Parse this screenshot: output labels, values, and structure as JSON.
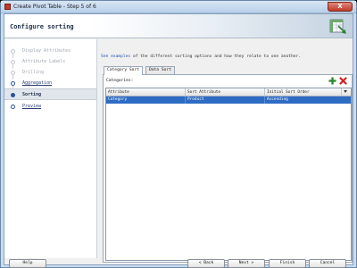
{
  "window": {
    "title": "Create Pivot Table - Step 5 of 6",
    "close_glyph": "X"
  },
  "header": {
    "title": "Configure sorting",
    "icon": "pivot-wizard-icon"
  },
  "steps": [
    {
      "label": "Display Attributes",
      "state": "done"
    },
    {
      "label": "Attribute Labels",
      "state": "done"
    },
    {
      "label": "Drilling",
      "state": "done"
    },
    {
      "label": "Aggregation",
      "state": "link"
    },
    {
      "label": "Sorting",
      "state": "current"
    },
    {
      "label": "Preview",
      "state": "next"
    }
  ],
  "main": {
    "info_link": "See examples",
    "info_rest": " of the different sorting options and how they relate to one another.",
    "tabs": [
      {
        "label": "Category Sort",
        "active": true
      },
      {
        "label": "Data Sort",
        "active": false
      }
    ],
    "categories_label": "Categories:",
    "table": {
      "columns": [
        "Attribute",
        "Sort Attribute",
        "Initial Sort Order"
      ],
      "rows": [
        [
          "Category",
          "Product",
          "Ascending"
        ]
      ]
    }
  },
  "footer": {
    "help": "Help",
    "back": "< Back",
    "next": "Next >",
    "finish": "Finish",
    "cancel": "Cancel"
  },
  "colors": {
    "selection": "#2e6cc4",
    "add": "#2e8b2e",
    "remove": "#d02020"
  }
}
